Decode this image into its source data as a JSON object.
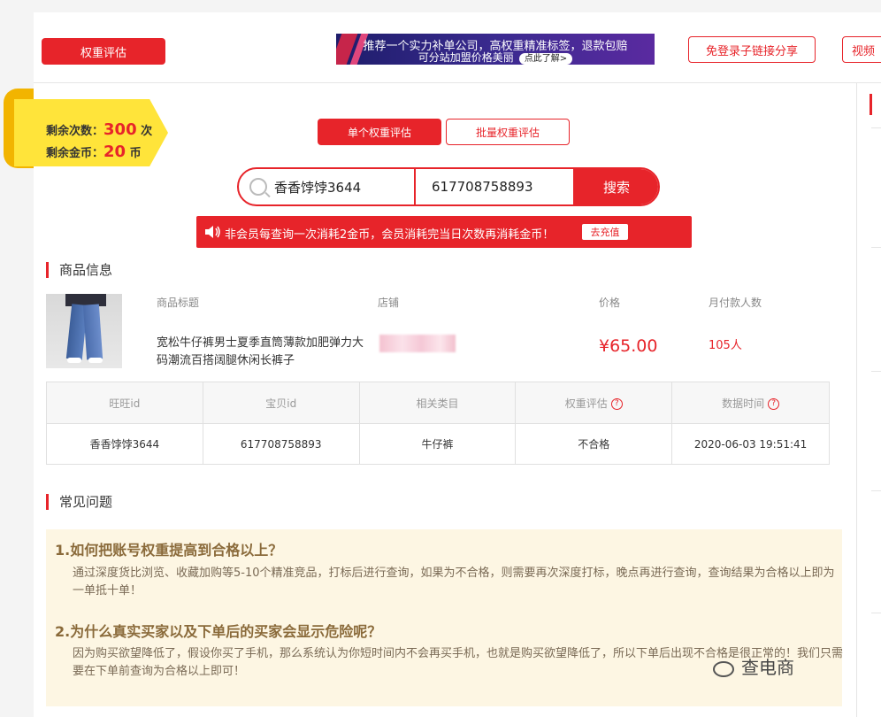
{
  "topbar": {
    "weight_eval_label": "权重评估",
    "banner_line1": "推荐一个实力补单公司，高权重精准标签，退款包赔",
    "banner_line2": "可分站加盟价格美丽",
    "banner_more": "点此了解>",
    "share_label": "免登录子链接分享",
    "video_label": "视频"
  },
  "ribbon": {
    "remaining_count_label": "剩余次数：",
    "remaining_count": "300",
    "count_unit": "次",
    "remaining_coins_label": "剩余金币：",
    "remaining_coins": "20",
    "coin_unit": "币"
  },
  "tabs": {
    "single": "单个权重评估",
    "batch": "批量权重评估"
  },
  "search": {
    "wangwang_value": "香香饽饽3644",
    "item_id_value": "617708758893",
    "button_label": "搜索"
  },
  "notice": {
    "text": "非会员每查询一次消耗2金币，会员消耗完当日次数再消耗金币！",
    "recharge_label": "去充值"
  },
  "product": {
    "section_title": "商品信息",
    "headers": {
      "title": "商品标题",
      "shop": "店铺",
      "price": "价格",
      "monthly_buyers": "月付款人数"
    },
    "title": "宽松牛仔裤男士夏季直筒薄款加肥弹力大码潮流百搭阔腿休闲长裤子",
    "price": "¥65.00",
    "monthly_buyers": "105人"
  },
  "result_table": {
    "headers": [
      "旺旺id",
      "宝贝id",
      "相关类目",
      "权重评估",
      "数据时间"
    ],
    "row": [
      "香香饽饽3644",
      "617708758893",
      "牛仔裤",
      "不合格",
      "2020-06-03 19:51:41"
    ]
  },
  "faq": {
    "section_title": "常见问题",
    "q1": "1.如何把账号权重提高到合格以上？",
    "a1": "通过深度货比浏览、收藏加购等5-10个精准竞品，打标后进行查询，如果为不合格，则需要再次深度打标，晚点再进行查询，查询结果为合格以上即为一单抵十单！",
    "q2": "2.为什么真实买家以及下单后的买家会显示危险呢？",
    "a2": "因为购买欲望降低了，假设你买了手机，那么系统认为你短时间内不会再买手机，也就是购买欲望降低了，所以下单后出现不合格是很正常的！我们只需要在下单前查询为合格以上即可！"
  },
  "watermark": "查电商",
  "colors": {
    "accent": "#e7242a",
    "ribbon": "#ffe43a",
    "faq_bg": "#fdf6e3"
  }
}
